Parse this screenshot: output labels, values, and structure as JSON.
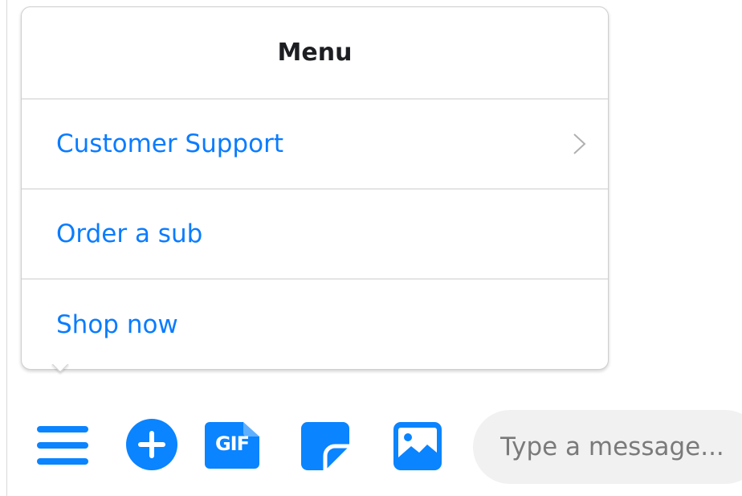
{
  "menu": {
    "title": "Menu",
    "items": [
      {
        "label": "Customer Support",
        "has_submenu": true
      },
      {
        "label": "Order a sub",
        "has_submenu": false
      },
      {
        "label": "Shop now",
        "has_submenu": false
      }
    ]
  },
  "composer": {
    "icons": [
      "menu-icon",
      "plus-icon",
      "gif-icon",
      "sticker-icon",
      "image-icon"
    ],
    "gif_label": "GIF",
    "message_placeholder": "Type a message..."
  },
  "colors": {
    "accent": "#0a84ff",
    "link": "#0a7cff",
    "input_bg": "#f1f1f1"
  }
}
